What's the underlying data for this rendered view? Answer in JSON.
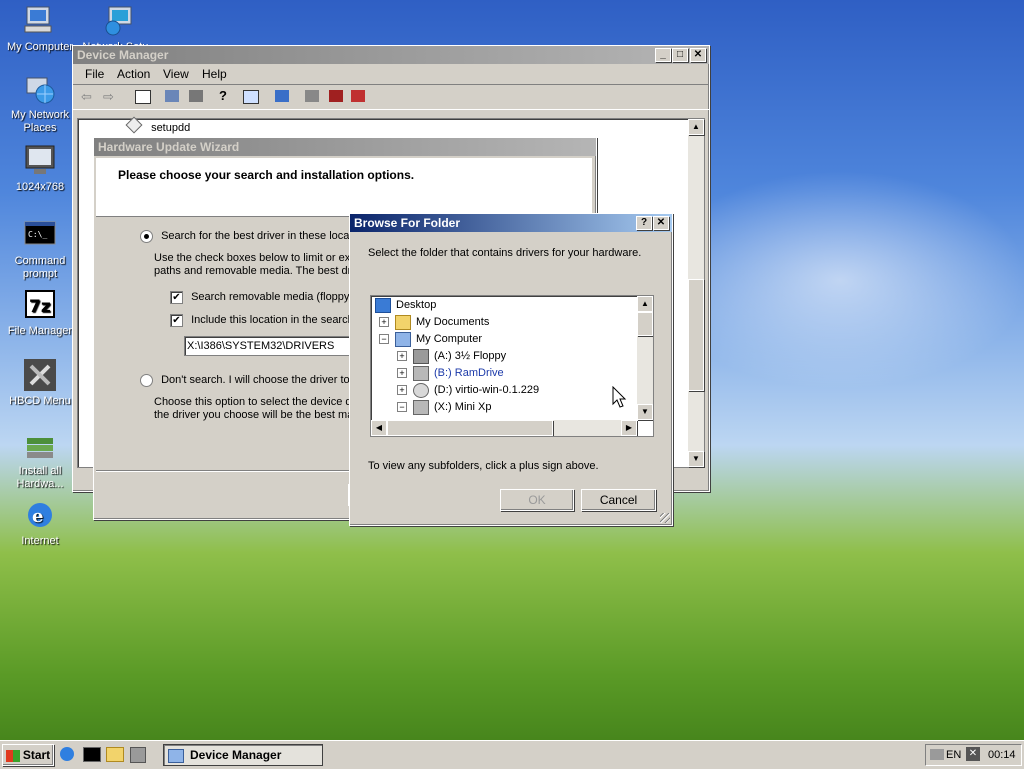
{
  "desktop": {
    "icons": [
      {
        "label": "My Computer"
      },
      {
        "label": "My Network Places"
      },
      {
        "label": "1024x768"
      },
      {
        "label": "Command prompt"
      },
      {
        "label": "File Manager"
      },
      {
        "label": "HBCD Menu"
      },
      {
        "label": "Install all Hardwa..."
      },
      {
        "label": "Internet"
      },
      {
        "label": "Network Setu..."
      }
    ]
  },
  "device_manager": {
    "title": "Device Manager",
    "menu": [
      "File",
      "Action",
      "View",
      "Help"
    ],
    "tree_item": "setupdd"
  },
  "wizard": {
    "title": "Hardware Update Wizard",
    "heading": "Please choose your search and installation options.",
    "radio_search": "Search for the best driver in these locatio",
    "search_desc_1": "Use the check boxes below to limit or exp",
    "search_desc_2": "paths and removable media. The best driv",
    "chk_removable": "Search removable media (floppy, C",
    "chk_include": "Include this location in the search:",
    "path_value": "X:\\I386\\SYSTEM32\\DRIVERS",
    "radio_dont": "Don't search. I will choose the driver to in",
    "dont_desc_1": "Choose this option to select the device dr",
    "dont_desc_2": "the driver you choose will be the best mat"
  },
  "browse": {
    "title": "Browse For Folder",
    "help_btn": "?",
    "close_btn": "✕",
    "instruction": "Select the folder that contains drivers for your hardware.",
    "tree": [
      {
        "label": "Desktop",
        "level": 0,
        "toggle": ""
      },
      {
        "label": "My Documents",
        "level": 1,
        "toggle": "+"
      },
      {
        "label": "My Computer",
        "level": 1,
        "toggle": "−"
      },
      {
        "label": "(A:) 3½ Floppy",
        "level": 2,
        "toggle": "+"
      },
      {
        "label": "(B:) RamDrive",
        "level": 2,
        "toggle": "+"
      },
      {
        "label": "(D:) virtio-win-0.1.229",
        "level": 2,
        "toggle": "+"
      },
      {
        "label": "(X:) Mini Xp",
        "level": 2,
        "toggle": "−"
      }
    ],
    "hint": "To view any subfolders, click a plus sign above.",
    "ok_label": "OK",
    "cancel_label": "Cancel"
  },
  "taskbar": {
    "start_label": "Start",
    "task_label": "Device Manager",
    "lang": "EN",
    "clock": "00:14"
  },
  "colors": {
    "active_title": "#0a246a",
    "face": "#d4d0c8",
    "link_blue": "#1c3aa9"
  }
}
